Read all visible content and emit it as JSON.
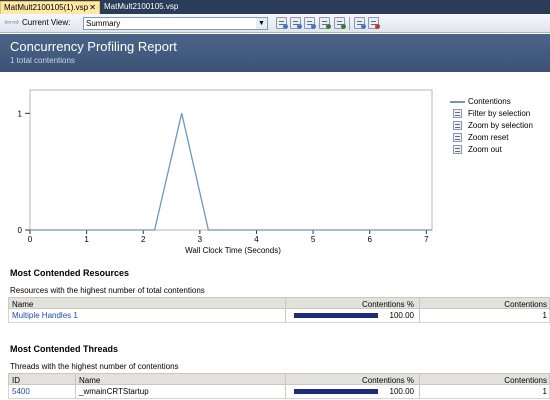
{
  "tabs": [
    {
      "label": "MatMult2100105(1).vsp",
      "active": true
    },
    {
      "label": "MatMult2100105.vsp",
      "active": false
    }
  ],
  "toolbar": {
    "current_view_label": "Current View:",
    "current_view_value": "Summary",
    "icons": [
      "report-summary-icon",
      "report-graph-icon",
      "report-table-icon",
      "export-icon",
      "options-icon",
      "compare-icon",
      "refresh-icon"
    ]
  },
  "header": {
    "title": "Concurrency Profiling Report",
    "subtitle": "1 total contentions"
  },
  "chart_data": {
    "type": "line",
    "xlabel": "Wall Clock Time (Seconds)",
    "ylabel": "",
    "xlim": [
      0,
      7.1
    ],
    "ylim": [
      0,
      1.2
    ],
    "x_ticks": [
      0,
      1,
      2,
      3,
      4,
      5,
      6,
      7
    ],
    "y_ticks": [
      0,
      1
    ],
    "grid": true,
    "legend_position": "right",
    "series": [
      {
        "name": "Contentions",
        "color": "#6f95c2",
        "x": [
          0,
          2.2,
          2.68,
          3.15,
          7.1
        ],
        "y": [
          0,
          0,
          1,
          0,
          0
        ]
      }
    ]
  },
  "legend_actions": [
    {
      "label": "Filter by selection",
      "icon": "filter-icon"
    },
    {
      "label": "Zoom by selection",
      "icon": "zoom-selection-icon"
    },
    {
      "label": "Zoom reset",
      "icon": "zoom-reset-icon"
    },
    {
      "label": "Zoom out",
      "icon": "zoom-out-icon"
    }
  ],
  "resources": {
    "title": "Most Contended Resources",
    "description": "Resources with the highest number of total contentions",
    "columns": [
      "Name",
      "Contentions %",
      "Contentions"
    ],
    "rows": [
      {
        "name": "Multiple Handles 1",
        "percent": 100.0,
        "percent_label": "100.00",
        "count": "1"
      }
    ]
  },
  "threads": {
    "title": "Most Contended Threads",
    "description": "Threads with the highest number of contentions",
    "columns": [
      "ID",
      "Name",
      "Contentions %",
      "Contentions"
    ],
    "rows": [
      {
        "id": "5400",
        "name": "_wmainCRTStartup",
        "percent": 100.0,
        "percent_label": "100.00",
        "count": "1"
      }
    ]
  },
  "colors": {
    "header_bg": "#41597d",
    "series_line": "#6f95c2",
    "bar_fill": "#1c2c7a",
    "link": "#1f4fa8",
    "active_tab": "#ffe8a6"
  }
}
